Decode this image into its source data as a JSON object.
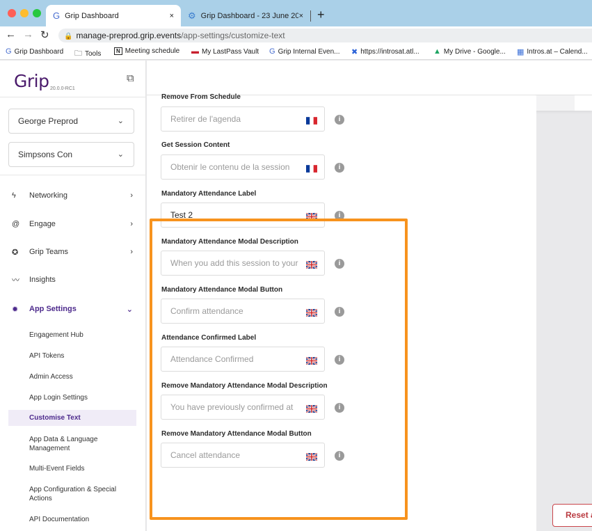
{
  "browser": {
    "tabs": [
      {
        "title": "Grip Dashboard",
        "close": "×",
        "icon": "G"
      },
      {
        "title": "Grip Dashboard - 23 June 202",
        "close": "×",
        "icon": "⚙"
      }
    ],
    "new_tab": "+",
    "url_host": "manage-preprod.grip.events",
    "url_path": "/app-settings/customize-text",
    "bookmarks": [
      {
        "label": "Grip Dashboard",
        "icon": "G"
      },
      {
        "label": "Tools",
        "icon": "🗀"
      },
      {
        "label": "Meeting schedule",
        "icon": "N"
      },
      {
        "label": "My LastPass Vault",
        "icon": "▬"
      },
      {
        "label": "Grip Internal Even...",
        "icon": "G"
      },
      {
        "label": "https://introsat.atl...",
        "icon": "✖"
      },
      {
        "label": "My Drive - Google...",
        "icon": "▲"
      },
      {
        "label": "Intros.at – Calend...",
        "icon": "▦"
      }
    ]
  },
  "sidebar": {
    "logo": "Grip",
    "version": "20.0.0-RC1",
    "org_select": "George Preprod",
    "event_select": "Simpsons Con",
    "nav": [
      {
        "label": "Networking",
        "icon": "ϟ"
      },
      {
        "label": "Engage",
        "icon": "@"
      },
      {
        "label": "Grip Teams",
        "icon": "✪"
      },
      {
        "label": "Insights",
        "icon": "〰"
      },
      {
        "label": "App Settings",
        "icon": "✹"
      }
    ],
    "sub_items": [
      "Engagement Hub",
      "API Tokens",
      "Admin Access",
      "App Login Settings",
      "Customise Text",
      "App Data & Language Management",
      "Multi-Event Fields",
      "App Configuration & Special Actions",
      "API Documentation"
    ]
  },
  "fields": [
    {
      "label": "Remove From Schedule",
      "value": "Retirer de l'agenda",
      "filled": false,
      "flag": "fr"
    },
    {
      "label": "Get Session Content",
      "value": "Obtenir le contenu de la session",
      "filled": false,
      "flag": "fr"
    },
    {
      "label": "Mandatory Attendance Label",
      "value": "Test 2",
      "filled": true,
      "flag": "uk"
    },
    {
      "label": "Mandatory Attendance Modal Description",
      "value": "When you add this session to your",
      "filled": false,
      "flag": "uk"
    },
    {
      "label": "Mandatory Attendance Modal Button",
      "value": "Confirm attendance",
      "filled": false,
      "flag": "uk"
    },
    {
      "label": "Attendance Confirmed Label",
      "value": "Attendance Confirmed",
      "filled": false,
      "flag": "uk"
    },
    {
      "label": "Remove Mandatory Attendance Modal Description",
      "value": "You have previously confirmed at",
      "filled": false,
      "flag": "uk"
    },
    {
      "label": "Remove Mandatory Attendance Modal Button",
      "value": "Cancel attendance",
      "filled": false,
      "flag": "uk"
    }
  ],
  "info_glyph": "i",
  "reset_button": "Reset a",
  "colors": {
    "accent": "#4d2a8c",
    "highlight": "#f7931e",
    "danger": "#c9444a"
  }
}
